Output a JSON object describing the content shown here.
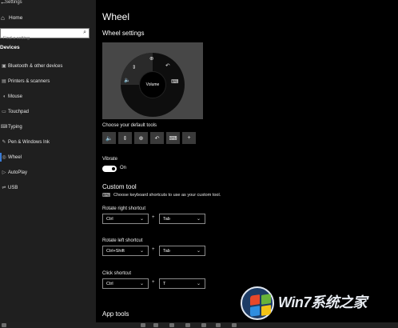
{
  "sidebar": {
    "window_title": "Settings",
    "home_label": "Home",
    "search_placeholder": "Find a setting",
    "section_title": "Devices",
    "items": [
      {
        "label": "Bluetooth & other devices",
        "icon": "bluetooth-icon"
      },
      {
        "label": "Printers & scanners",
        "icon": "printer-icon"
      },
      {
        "label": "Mouse",
        "icon": "mouse-icon"
      },
      {
        "label": "Touchpad",
        "icon": "touchpad-icon"
      },
      {
        "label": "Typing",
        "icon": "keyboard-icon"
      },
      {
        "label": "Pen & Windows Ink",
        "icon": "pen-icon"
      },
      {
        "label": "Wheel",
        "icon": "wheel-icon",
        "selected": true
      },
      {
        "label": "AutoPlay",
        "icon": "autoplay-icon"
      },
      {
        "label": "USB",
        "icon": "usb-icon"
      }
    ]
  },
  "main": {
    "title": "Wheel",
    "wheel_settings": "Wheel settings",
    "wheel_center_label": "Volume",
    "default_tools_label": "Choose your default tools",
    "vibrate_label": "Vibrate",
    "vibrate_state": "On",
    "custom_tool_title": "Custom tool",
    "custom_tool_desc": "Choose keyboard shortcuts to use as your custom tool.",
    "rotate_right_label": "Rotate right shortcut",
    "rotate_right_key1": "Ctrl",
    "rotate_right_key2": "Tab",
    "rotate_left_label": "Rotate left shortcut",
    "rotate_left_key1": "Ctrl+Shift",
    "rotate_left_key2": "Tab",
    "click_label": "Click shortcut",
    "click_key1": "Ctrl",
    "click_key2": "T",
    "plus_sign": "+",
    "app_tools_title": "App tools"
  },
  "watermark": {
    "brand": "Win7系统之家"
  },
  "colors": {
    "sidebar_bg": "#1f1f1f",
    "main_bg": "#000000",
    "accent": "#3a7bd5",
    "wheel_box_bg": "#474747"
  }
}
